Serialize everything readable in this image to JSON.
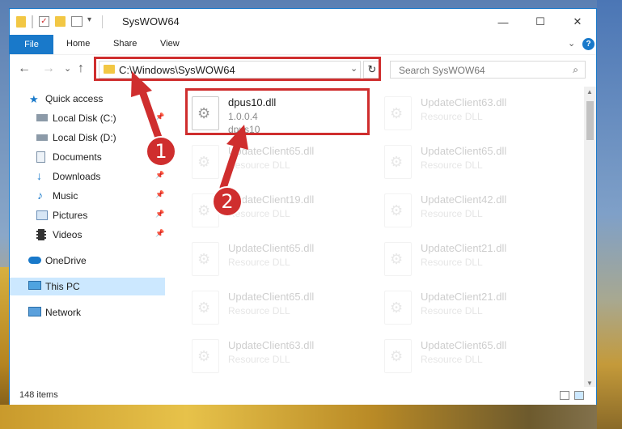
{
  "window": {
    "title": "SysWOW64",
    "controls": {
      "minimize": "—",
      "maximize": "☐",
      "close": "✕"
    }
  },
  "ribbon": {
    "tabs": [
      "File",
      "Home",
      "Share",
      "View"
    ],
    "help": "?"
  },
  "navigation": {
    "back": "←",
    "forward": "→",
    "recent": "⌄",
    "up": "↑",
    "address": "C:\\Windows\\SysWOW64",
    "address_dropdown": "⌄",
    "refresh": "↻",
    "search_placeholder": "Search SysWOW64"
  },
  "sidebar": {
    "items": [
      {
        "label": "Quick access",
        "icon": "star-icon",
        "pinned": false
      },
      {
        "label": "Local Disk (C:)",
        "icon": "drive-icon",
        "pinned": true
      },
      {
        "label": "Local Disk (D:)",
        "icon": "drive-icon",
        "pinned": false
      },
      {
        "label": "Documents",
        "icon": "documents-icon",
        "pinned": true
      },
      {
        "label": "Downloads",
        "icon": "download-icon",
        "pinned": true
      },
      {
        "label": "Music",
        "icon": "music-icon",
        "pinned": true
      },
      {
        "label": "Pictures",
        "icon": "pictures-icon",
        "pinned": true
      },
      {
        "label": "Videos",
        "icon": "videos-icon",
        "pinned": true
      },
      {
        "label": "OneDrive",
        "icon": "cloud-icon",
        "pinned": false
      },
      {
        "label": "This PC",
        "icon": "computer-icon",
        "pinned": false,
        "selected": true
      },
      {
        "label": "Network",
        "icon": "network-icon",
        "pinned": false
      }
    ]
  },
  "files": [
    {
      "name": "dpus10.dll",
      "line2": "1.0.0.4",
      "line3": "dpus10",
      "highlighted": true
    },
    {
      "name": "UpdateClient63.dll",
      "line2": "Resource DLL"
    },
    {
      "name": "UpdateClient65.dll",
      "line2": "Resource DLL"
    },
    {
      "name": "UpdateClient65.dll",
      "line2": "Resource DLL"
    },
    {
      "name": "UpdateClient19.dll",
      "line2": "Resource DLL"
    },
    {
      "name": "UpdateClient42.dll",
      "line2": "Resource DLL"
    },
    {
      "name": "UpdateClient65.dll",
      "line2": "Resource DLL"
    },
    {
      "name": "UpdateClient21.dll",
      "line2": "Resource DLL"
    },
    {
      "name": "UpdateClient65.dll",
      "line2": "Resource DLL"
    },
    {
      "name": "UpdateClient21.dll",
      "line2": "Resource DLL"
    },
    {
      "name": "UpdateClient63.dll",
      "line2": "Resource DLL"
    },
    {
      "name": "UpdateClient65.dll",
      "line2": "Resource DLL"
    }
  ],
  "status": {
    "item_count": "148 items"
  },
  "annotations": {
    "step1": "1",
    "step2": "2",
    "color": "#cf2e2e"
  }
}
